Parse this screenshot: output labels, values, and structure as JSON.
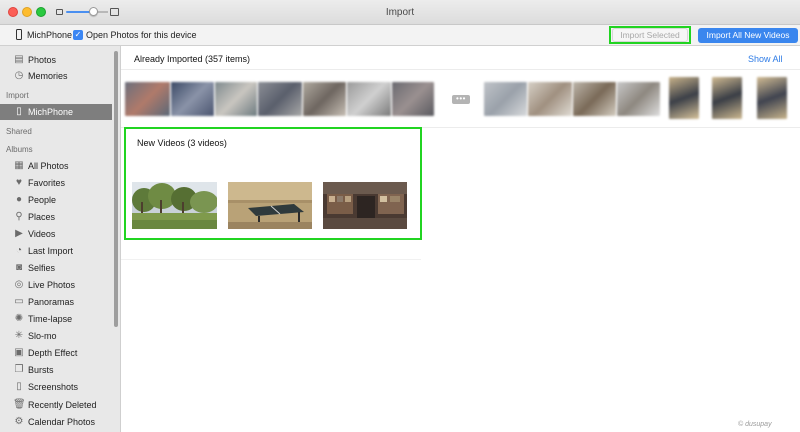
{
  "window": {
    "title": "Import"
  },
  "toolbar": {
    "device_name": "MichPhone",
    "open_photos_label": "Open Photos for this device",
    "open_photos_checked": true,
    "import_selected_label": "Import Selected",
    "import_all_label": "Import All New Videos"
  },
  "sidebar": {
    "library": [
      {
        "label": "Photos",
        "icon": "photos-icon"
      },
      {
        "label": "Memories",
        "icon": "memories-icon"
      }
    ],
    "import_heading": "Import",
    "import_item": {
      "label": "MichPhone",
      "icon": "phone-icon"
    },
    "shared_heading": "Shared",
    "albums_heading": "Albums",
    "albums": [
      {
        "label": "All Photos",
        "icon": "album-icon"
      },
      {
        "label": "Favorites",
        "icon": "heart-icon"
      },
      {
        "label": "People",
        "icon": "person-icon"
      },
      {
        "label": "Places",
        "icon": "pin-icon"
      },
      {
        "label": "Videos",
        "icon": "video-icon"
      },
      {
        "label": "Last Import",
        "icon": "clock-icon"
      },
      {
        "label": "Selfies",
        "icon": "camera-icon"
      },
      {
        "label": "Live Photos",
        "icon": "live-icon"
      },
      {
        "label": "Panoramas",
        "icon": "panorama-icon"
      },
      {
        "label": "Time-lapse",
        "icon": "timelapse-icon"
      },
      {
        "label": "Slo-mo",
        "icon": "slomo-icon"
      },
      {
        "label": "Depth Effect",
        "icon": "cube-icon"
      },
      {
        "label": "Bursts",
        "icon": "bursts-icon"
      },
      {
        "label": "Screenshots",
        "icon": "screenshot-icon"
      },
      {
        "label": "Recently Deleted",
        "icon": "trash-icon"
      },
      {
        "label": "Calendar Photos",
        "icon": "gear-icon"
      }
    ]
  },
  "main": {
    "already_imported_title": "Already Imported (357 items)",
    "show_all_label": "Show All",
    "new_videos_title": "New Videos (3 videos)"
  },
  "watermark": "© dusupay"
}
